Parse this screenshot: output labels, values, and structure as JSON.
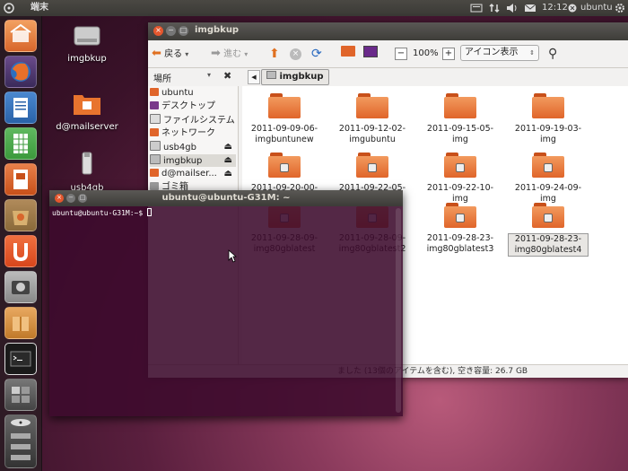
{
  "top_panel": {
    "app_name": "端末",
    "clock": "12:12",
    "user": "ubuntu"
  },
  "launcher": {
    "items": [
      {
        "name": "home-folder-launcher",
        "color": "#d8662c"
      },
      {
        "name": "firefox-launcher",
        "color": "#2c6fbf"
      },
      {
        "name": "writer-launcher",
        "color": "#2a62a8"
      },
      {
        "name": "calc-launcher",
        "color": "#3c9a3c"
      },
      {
        "name": "impress-launcher",
        "color": "#c8501a"
      },
      {
        "name": "software-center-launcher",
        "color": "#8a6a3a"
      },
      {
        "name": "ubuntu-one-launcher",
        "color": "#d8461c"
      },
      {
        "name": "screenshot-launcher",
        "color": "#888888"
      },
      {
        "name": "package-launcher",
        "color": "#d08a3a"
      },
      {
        "name": "terminal-launcher",
        "color": "#2a2a2a"
      },
      {
        "name": "workspaces-launcher",
        "color": "#555555"
      }
    ]
  },
  "desktop": {
    "icons": [
      {
        "label": "imgbkup"
      },
      {
        "label": "d@mailserver"
      },
      {
        "label": "usb4gb"
      }
    ]
  },
  "file_manager": {
    "title": "imgbkup",
    "toolbar": {
      "back": "戻る",
      "forward": "進む",
      "zoom": "100%",
      "view_mode": "アイコン表示"
    },
    "sidebar_header": "場所",
    "location_button": "imgbkup",
    "sidebar": [
      "ubuntu",
      "デスクトップ",
      "ファイルシステム",
      "ネットワーク",
      "usb4gb",
      "imgbkup",
      "d@mailser...",
      "ゴミ箱"
    ],
    "files": [
      {
        "name": "2011-09-09-06-imgbuntunew",
        "locked": false
      },
      {
        "name": "2011-09-12-02-imgubuntu",
        "locked": false
      },
      {
        "name": "2011-09-15-05-img",
        "locked": false
      },
      {
        "name": "2011-09-19-03-img",
        "locked": false
      },
      {
        "name": "2011-09-20-00-img",
        "locked": true
      },
      {
        "name": "2011-09-22-05-img",
        "locked": true
      },
      {
        "name": "2011-09-22-10-img",
        "locked": true
      },
      {
        "name": "2011-09-24-09-img",
        "locked": true
      },
      {
        "name": "2011-09-28-09-img80gblatest",
        "locked": true
      },
      {
        "name": "2011-09-28-09-img80gblatest2",
        "locked": true
      },
      {
        "name": "2011-09-28-23-img80gblatest3",
        "locked": true
      },
      {
        "name": "2011-09-28-23-img80gblatest4",
        "locked": true
      }
    ],
    "status": "ました (13個のアイテムを含む), 空き容量: 26.7 GB"
  },
  "terminal": {
    "title": "ubuntu@ubuntu-G31M: ~",
    "prompt": "ubuntu@ubuntu-G31M:~$ "
  }
}
